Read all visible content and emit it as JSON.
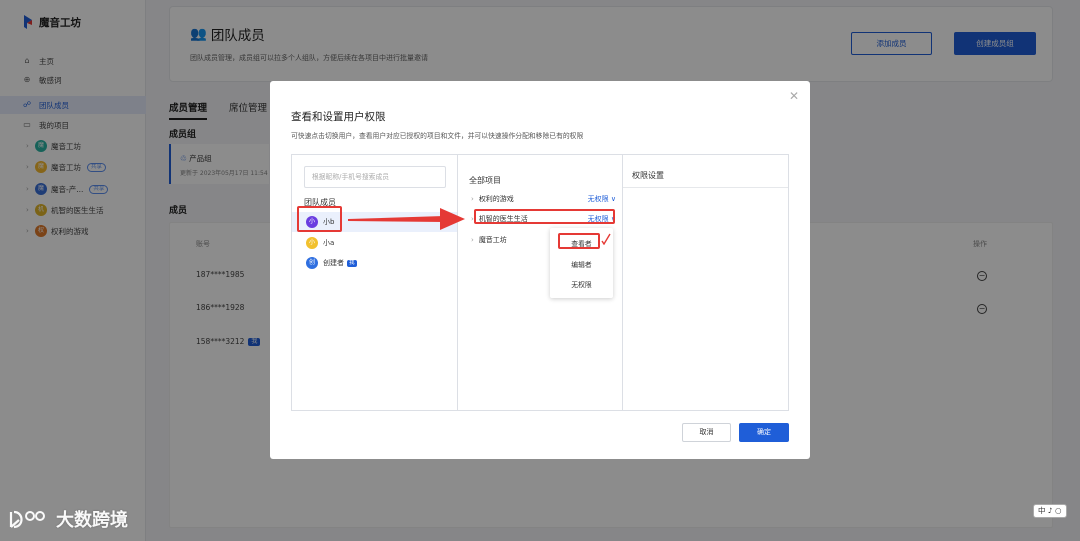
{
  "app": {
    "name": "魔音工坊"
  },
  "sidebar": {
    "nav": [
      {
        "label": "主页",
        "icon": "home-icon"
      },
      {
        "label": "敏感词",
        "icon": "sensitive-icon"
      },
      {
        "label": "团队成员",
        "icon": "team-icon"
      },
      {
        "label": "我的项目",
        "icon": "folder-icon"
      }
    ],
    "projects": [
      {
        "label": "魔音工坊",
        "badge": "魔",
        "color": "#2bb3a3",
        "tag": ""
      },
      {
        "label": "魔音工坊",
        "badge": "魔",
        "color": "#f5b82e",
        "tag": "共享"
      },
      {
        "label": "魔音-产...",
        "badge": "魔",
        "color": "#3a6fd8",
        "tag": "共享"
      },
      {
        "label": "机智的医生生活",
        "badge": "机",
        "color": "#e0b42a",
        "tag": ""
      },
      {
        "label": "权利的游戏",
        "badge": "权",
        "color": "#e07a2a",
        "tag": ""
      }
    ]
  },
  "header": {
    "title": "团队成员",
    "description": "团队成员管理，成员组可以拉多个人组队，方便后续在各项目中进行批量邀请",
    "add_member": "添加成员",
    "create_group": "创建成员组"
  },
  "tabs": [
    "成员管理",
    "席位管理"
  ],
  "group_section": {
    "label": "成员组",
    "group_name": "产品组",
    "updated": "更新于 2023年05月17日 11:54"
  },
  "member_section": {
    "label": "成员",
    "col_account": "账号",
    "col_action": "操作",
    "rows": [
      {
        "account": "187****1985",
        "me": ""
      },
      {
        "account": "186****1928",
        "me": ""
      },
      {
        "account": "158****3212",
        "me": "我"
      }
    ]
  },
  "modal": {
    "title": "查看和设置用户权限",
    "description": "可快速点击切换用户，查看用户对应已授权的项目和文件，并可以快速操作分配和移除已有的权限",
    "search_placeholder": "根据昵称/手机号搜索成员",
    "team_label": "团队成员",
    "members": [
      {
        "name": "小b",
        "avatar": "小",
        "color": "#6a3de0",
        "tag": ""
      },
      {
        "name": "小a",
        "avatar": "小",
        "color": "#f2c12e",
        "tag": ""
      },
      {
        "name": "创建者",
        "avatar": "创",
        "color": "#2f6fe0",
        "tag": "我"
      }
    ],
    "all_projects": "全部项目",
    "projects": [
      {
        "name": "权利的游戏",
        "perm": "无权限 ∨"
      },
      {
        "name": "机智的医生生活",
        "perm": "无权限 ∨"
      },
      {
        "name": "魔音工坊",
        "perm": ""
      }
    ],
    "dropdown": [
      "查看者",
      "编辑者",
      "无权限"
    ],
    "perm_title": "权限设置",
    "cancel": "取消",
    "confirm": "确定"
  },
  "watermark": "大数跨境",
  "ime": "中 ♪ ○"
}
